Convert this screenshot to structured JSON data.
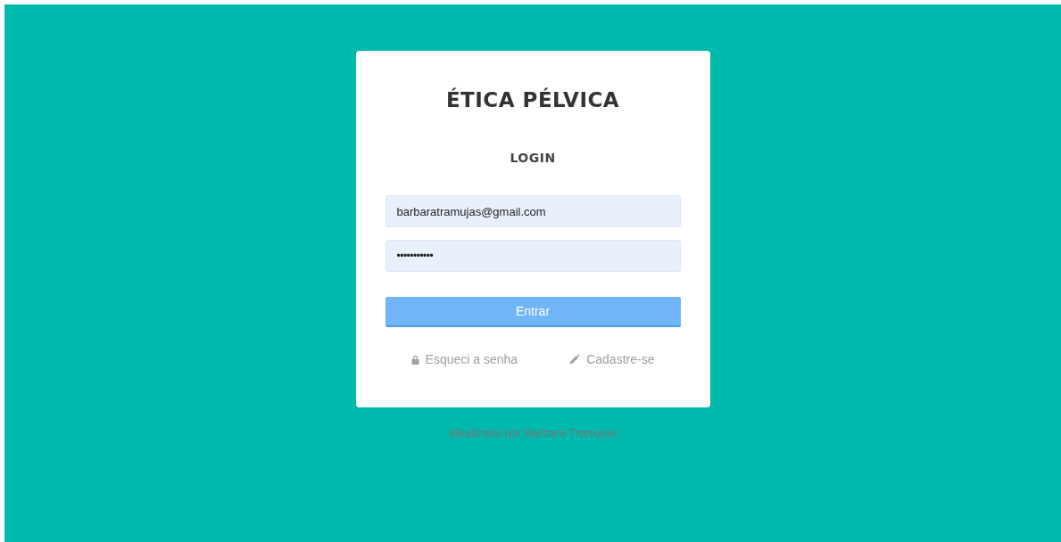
{
  "brand": "ÉTICA PÉLVICA",
  "heading": "LOGIN",
  "fields": [
    {
      "kind": "email",
      "value": "barbaratramujas@gmail.com"
    },
    {
      "kind": "password",
      "value": "•••••••••••"
    }
  ],
  "submit": "Entrar",
  "links": [
    {
      "kind": "lock",
      "label": "Esqueci a senha"
    },
    {
      "kind": "pencil",
      "label": "Cadastre-se"
    }
  ],
  "footer": "Idealizado por Barbara Tramujas"
}
